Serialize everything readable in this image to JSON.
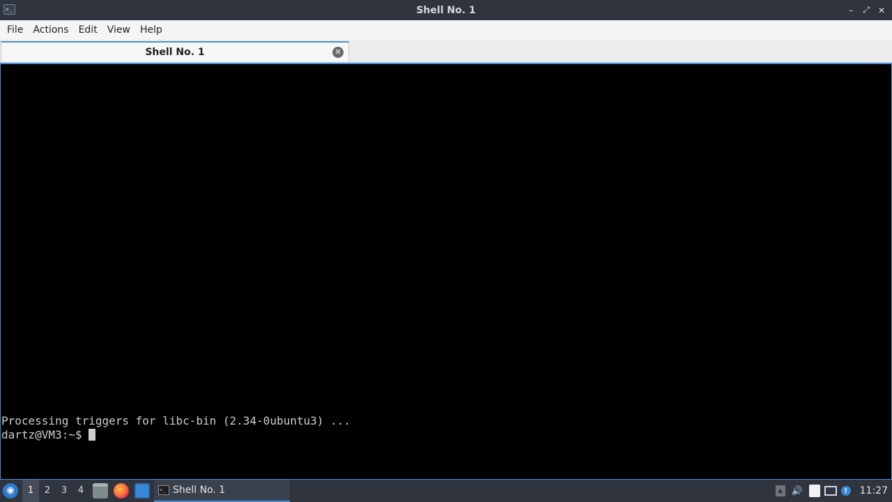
{
  "window": {
    "title": "Shell No. 1",
    "app_icon": "terminal-icon",
    "controls": {
      "minimize": "–",
      "maximize": "⤢",
      "close": "✕"
    }
  },
  "menu": [
    {
      "label": "File"
    },
    {
      "label": "Actions"
    },
    {
      "label": "Edit"
    },
    {
      "label": "View"
    },
    {
      "label": "Help"
    }
  ],
  "tabs": [
    {
      "label": "Shell No. 1",
      "active": true,
      "close_icon": "close-circle-icon"
    }
  ],
  "terminal": {
    "lines": [
      "Processing triggers for libc-bin (2.34-0ubuntu3) ...",
      "dartz@VM3:~$ "
    ],
    "colors": {
      "background": "#000000",
      "foreground": "#cfcfcf"
    }
  },
  "taskbar": {
    "start_icon": "lxqt-start-icon",
    "desktops": [
      {
        "label": "1",
        "active": true
      },
      {
        "label": "2"
      },
      {
        "label": "3"
      },
      {
        "label": "4"
      }
    ],
    "quick_launch": [
      {
        "icon": "file-manager-icon"
      },
      {
        "icon": "firefox-icon"
      },
      {
        "icon": "show-desktop-icon"
      }
    ],
    "task": {
      "label": "Shell No. 1",
      "icon": "terminal-icon"
    },
    "tray": [
      {
        "icon": "tray-expand-icon"
      },
      {
        "icon": "volume-icon"
      },
      {
        "icon": "clipboard-icon"
      },
      {
        "icon": "network-icon"
      },
      {
        "icon": "update-notifier-icon"
      }
    ],
    "clock": "11:27"
  },
  "theme": {
    "accent": "#4a90d9",
    "titlebar": "#2f343f"
  }
}
